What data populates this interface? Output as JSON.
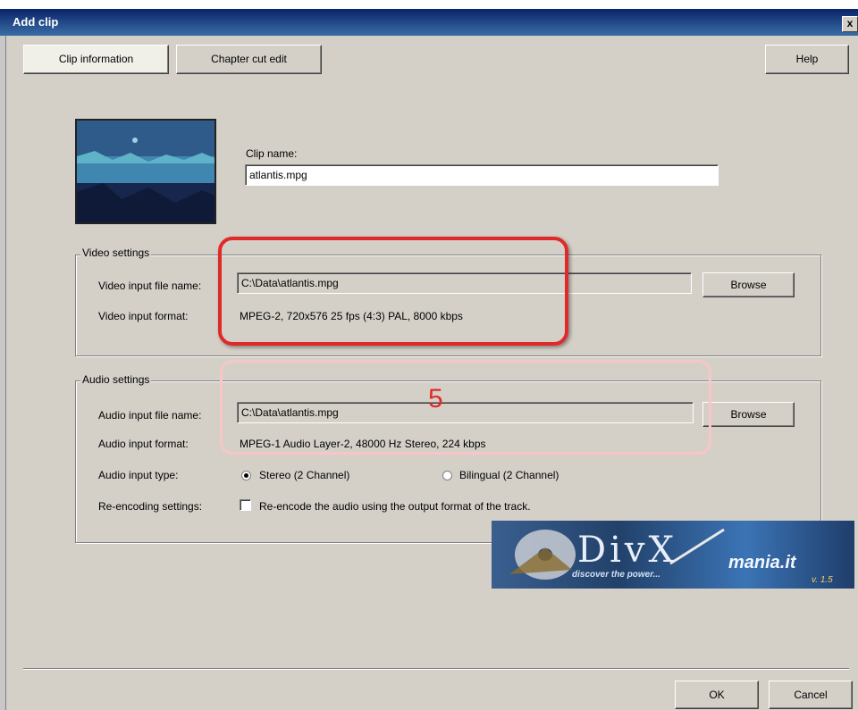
{
  "window": {
    "title": "Add clip",
    "close": "x"
  },
  "tabs": {
    "clip_info": "Clip information",
    "chapter_cut": "Chapter cut edit"
  },
  "help_label": "Help",
  "clip": {
    "name_label": "Clip name:",
    "name_value": "atlantis.mpg"
  },
  "video": {
    "group_label": "Video settings",
    "file_label": "Video input file name:",
    "file_value": "C:\\Data\\atlantis.mpg",
    "browse_label": "Browse",
    "format_label": "Video input format:",
    "format_value": "MPEG-2, 720x576 25 fps (4:3) PAL, 8000 kbps"
  },
  "audio": {
    "group_label": "Audio settings",
    "file_label": "Audio input file name:",
    "file_value": "C:\\Data\\atlantis.mpg",
    "browse_label": "Browse",
    "format_label": "Audio input format:",
    "format_value": "MPEG-1 Audio Layer-2, 48000 Hz Stereo, 224 kbps",
    "type_label": "Audio input type:",
    "type_stereo": "Stereo (2 Channel)",
    "type_bilingual": "Bilingual (2 Channel)",
    "type_selected": "Stereo (2 Channel)",
    "reencode_label": "Re-encoding settings:",
    "reencode_text": "Re-encode the audio using the output format of the track.",
    "reencode_checked": false
  },
  "annotation_number": "5",
  "divx_banner": {
    "logo": "DivX",
    "tagline": "discover the power...",
    "site": "mania.it",
    "version": "v. 1.5"
  },
  "footer": {
    "ok_label": "OK",
    "cancel_label": "Cancel"
  },
  "colors": {
    "highlight_red": "#e02a2a",
    "highlight_pink": "#f8c6c6",
    "titlebar": "#0a246a"
  }
}
